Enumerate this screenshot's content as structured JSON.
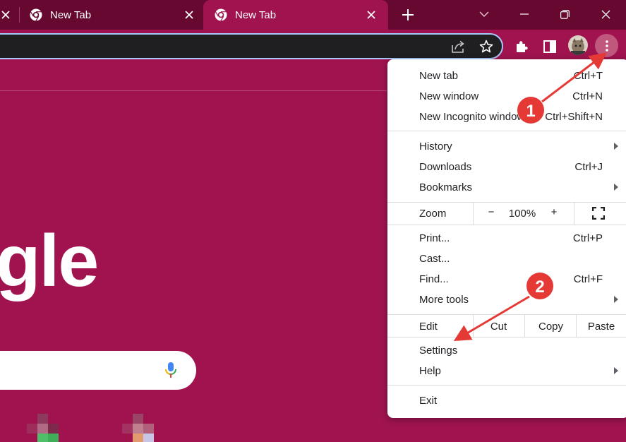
{
  "tabs": [
    {
      "title": "New Tab"
    },
    {
      "title": "New Tab"
    }
  ],
  "colors": {
    "tabstrip": "#66082f",
    "theme": "#a0134f",
    "omnibox": "#1f1f21",
    "omnibox_focus": "#a8c7fa",
    "menu_button_hover": "#c0587e",
    "annotation": "#e53935"
  },
  "icons": {
    "tab_favicon": "chrome-icon",
    "new_tab": "plus-icon",
    "tab_search": "chevron-down-icon",
    "minimize": "minimize-icon",
    "maximize": "restore-icon",
    "close": "close-icon",
    "share": "share-icon",
    "bookmark": "star-icon",
    "extensions": "puzzle-icon",
    "side_panel": "side-panel-icon",
    "menu": "three-dot-icon",
    "voice": "mic-icon",
    "fullscreen": "fullscreen-icon"
  },
  "page": {
    "logo_partial": "gle"
  },
  "menu": {
    "groups": [
      [
        {
          "label": "New tab",
          "shortcut": "Ctrl+T"
        },
        {
          "label": "New window",
          "shortcut": "Ctrl+N"
        },
        {
          "label": "New Incognito window",
          "shortcut": "Ctrl+Shift+N"
        }
      ],
      [
        {
          "label": "History",
          "submenu": true
        },
        {
          "label": "Downloads",
          "shortcut": "Ctrl+J"
        },
        {
          "label": "Bookmarks",
          "submenu": true
        }
      ],
      [
        {
          "label": "Print...",
          "shortcut": "Ctrl+P"
        },
        {
          "label": "Cast..."
        },
        {
          "label": "Find...",
          "shortcut": "Ctrl+F"
        },
        {
          "label": "More tools",
          "submenu": true
        }
      ],
      [
        {
          "label": "Settings"
        },
        {
          "label": "Help",
          "submenu": true
        }
      ],
      [
        {
          "label": "Exit"
        }
      ]
    ],
    "zoom": {
      "label": "Zoom",
      "minus": "−",
      "value": "100%",
      "plus": "+"
    },
    "edit": {
      "label": "Edit",
      "cut": "Cut",
      "copy": "Copy",
      "paste": "Paste"
    }
  },
  "annotations": [
    {
      "number": "1",
      "target": "menu-button"
    },
    {
      "number": "2",
      "target": "Settings"
    }
  ]
}
